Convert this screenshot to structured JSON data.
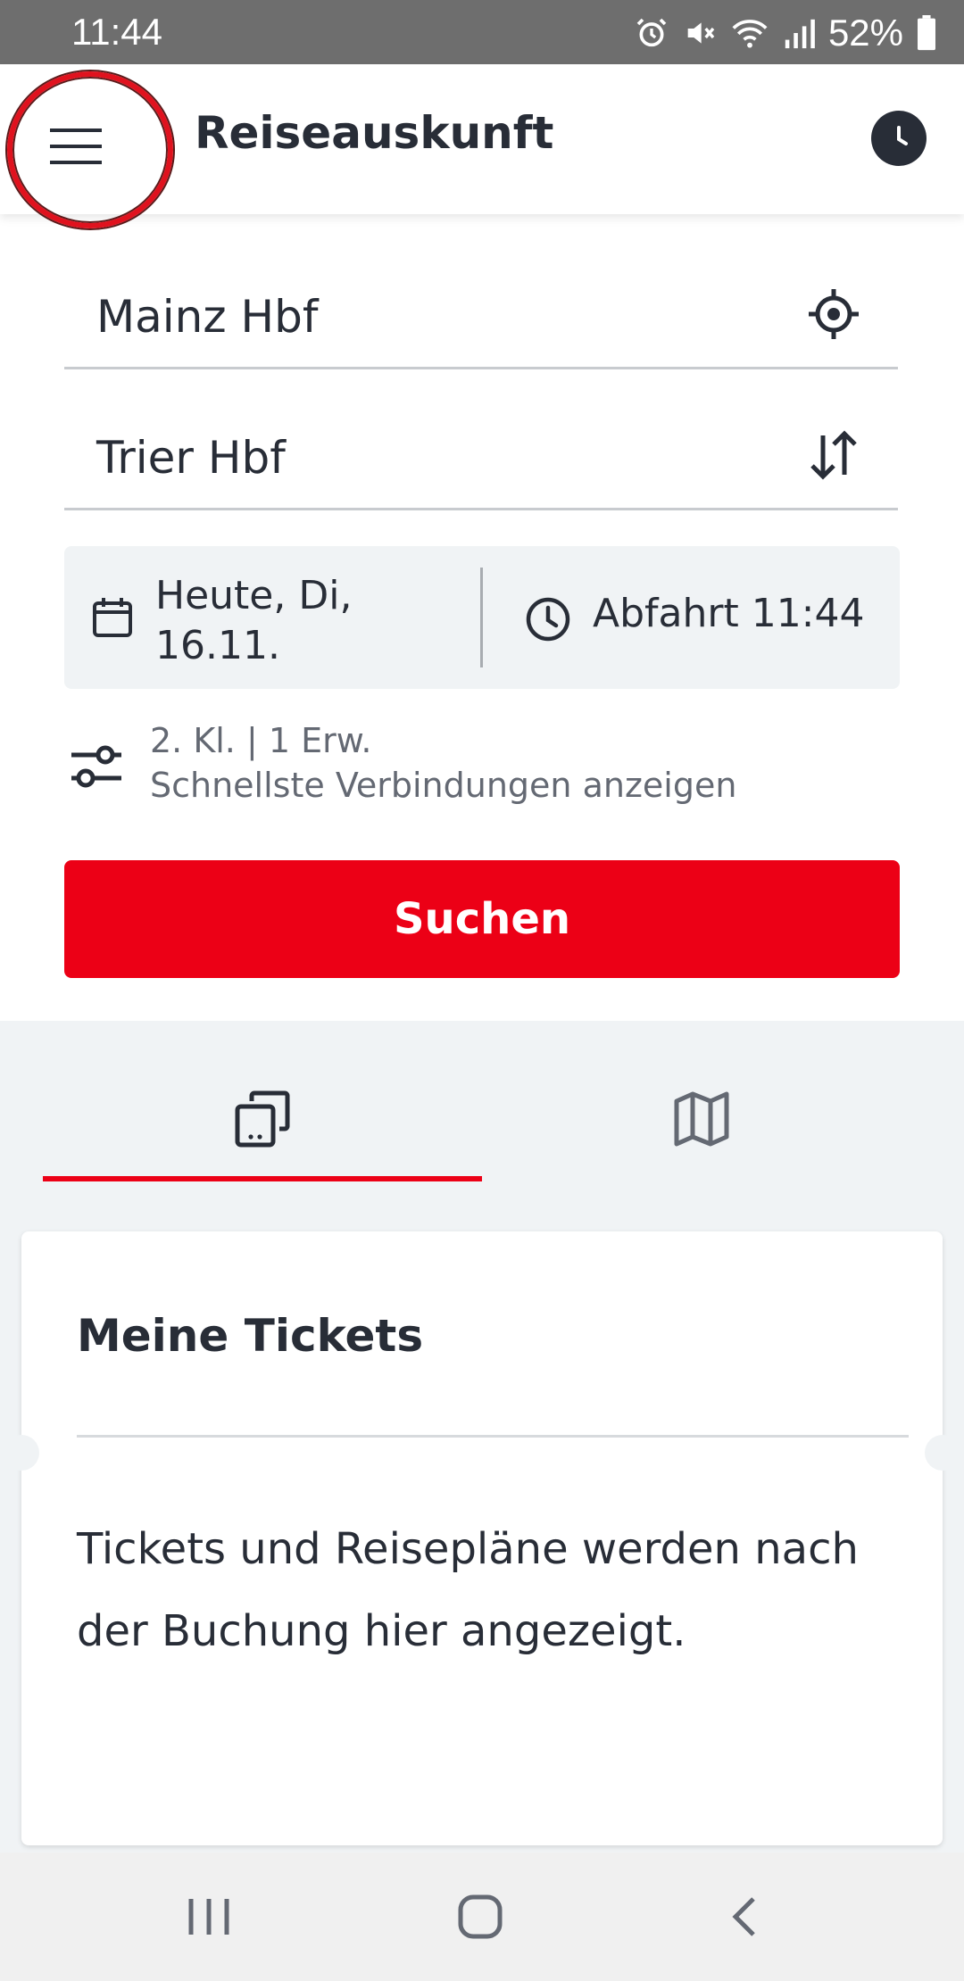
{
  "status_bar": {
    "time": "11:44",
    "battery": "52%",
    "icons": [
      "alarm-icon",
      "mute-icon",
      "wifi-icon",
      "signal-icon",
      "battery-icon"
    ]
  },
  "app_bar": {
    "menu_icon": "hamburger-menu-icon",
    "title": "Reiseauskunft",
    "history_icon": "clock-icon"
  },
  "search": {
    "from": "Mainz Hbf",
    "to": "Trier Hbf",
    "from_icon": "location-target-icon",
    "to_icon": "swap-arrows-icon",
    "date_line1": "Heute, Di,",
    "date_line2": "16.11.",
    "time": "Abfahrt 11:44",
    "options_line1": "2. Kl. | 1 Erw.",
    "options_line2": "Schnellste Verbindungen anzeigen",
    "search_button": "Suchen"
  },
  "tabs": [
    {
      "icon": "tickets-icon",
      "active": true
    },
    {
      "icon": "map-icon",
      "active": false
    }
  ],
  "tickets": {
    "title": "Meine Tickets",
    "info": "Tickets und Reisepläne werden nach der Buchung hier angezeigt."
  },
  "nav_bar": {
    "icons": [
      "recent-apps-icon",
      "home-icon",
      "back-icon"
    ]
  },
  "colors": {
    "accent_red": "#ec0016",
    "text_dark": "#282d37",
    "background": "#f0f3f5"
  }
}
